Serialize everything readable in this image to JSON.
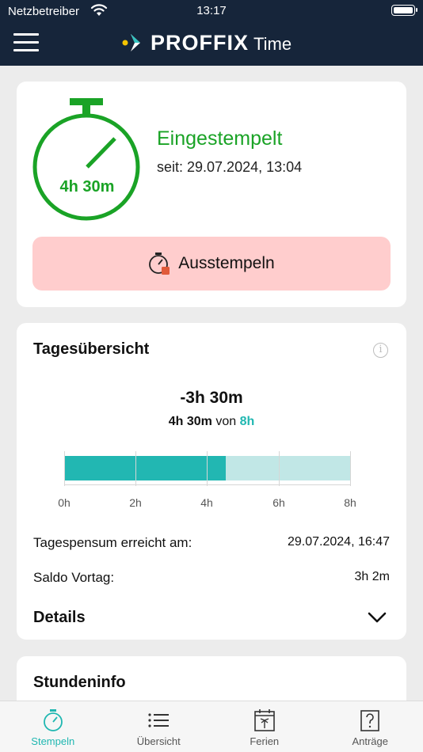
{
  "status_bar": {
    "carrier": "Netzbetreiber",
    "time": "13:17"
  },
  "header": {
    "brand": "PROFFIX",
    "brand_sub": "Time",
    "logo": "proffix-logo-icon"
  },
  "clock_card": {
    "elapsed": "4h 30m",
    "status": "Eingestempelt",
    "since": "seit: 29.07.2024, 13:04",
    "button_label": "Ausstempeln",
    "status_color": "#1aa326",
    "button_color": "#ffcdcd"
  },
  "day_overview": {
    "title": "Tagesübersicht",
    "balance": "-3h 30m",
    "worked": "4h 30m",
    "of": "von",
    "target": "8h",
    "progress_fraction": 0.5625,
    "axis_ticks": [
      "0h",
      "2h",
      "4h",
      "6h",
      "8h"
    ],
    "rows": [
      {
        "label": "Tagespensum erreicht am:",
        "value": "29.07.2024, 16:47"
      },
      {
        "label": "Saldo Vortag:",
        "value": "3h 2m"
      }
    ],
    "details_label": "Details",
    "accent_color": "#22b7b2"
  },
  "hours_info": {
    "title": "Stundeninfo"
  },
  "tabs": [
    {
      "label": "Stempeln",
      "icon": "stopwatch-icon",
      "active": true
    },
    {
      "label": "Übersicht",
      "icon": "list-icon",
      "active": false
    },
    {
      "label": "Ferien",
      "icon": "calendar-palm-icon",
      "active": false
    },
    {
      "label": "Anträge",
      "icon": "question-document-icon",
      "active": false
    }
  ]
}
